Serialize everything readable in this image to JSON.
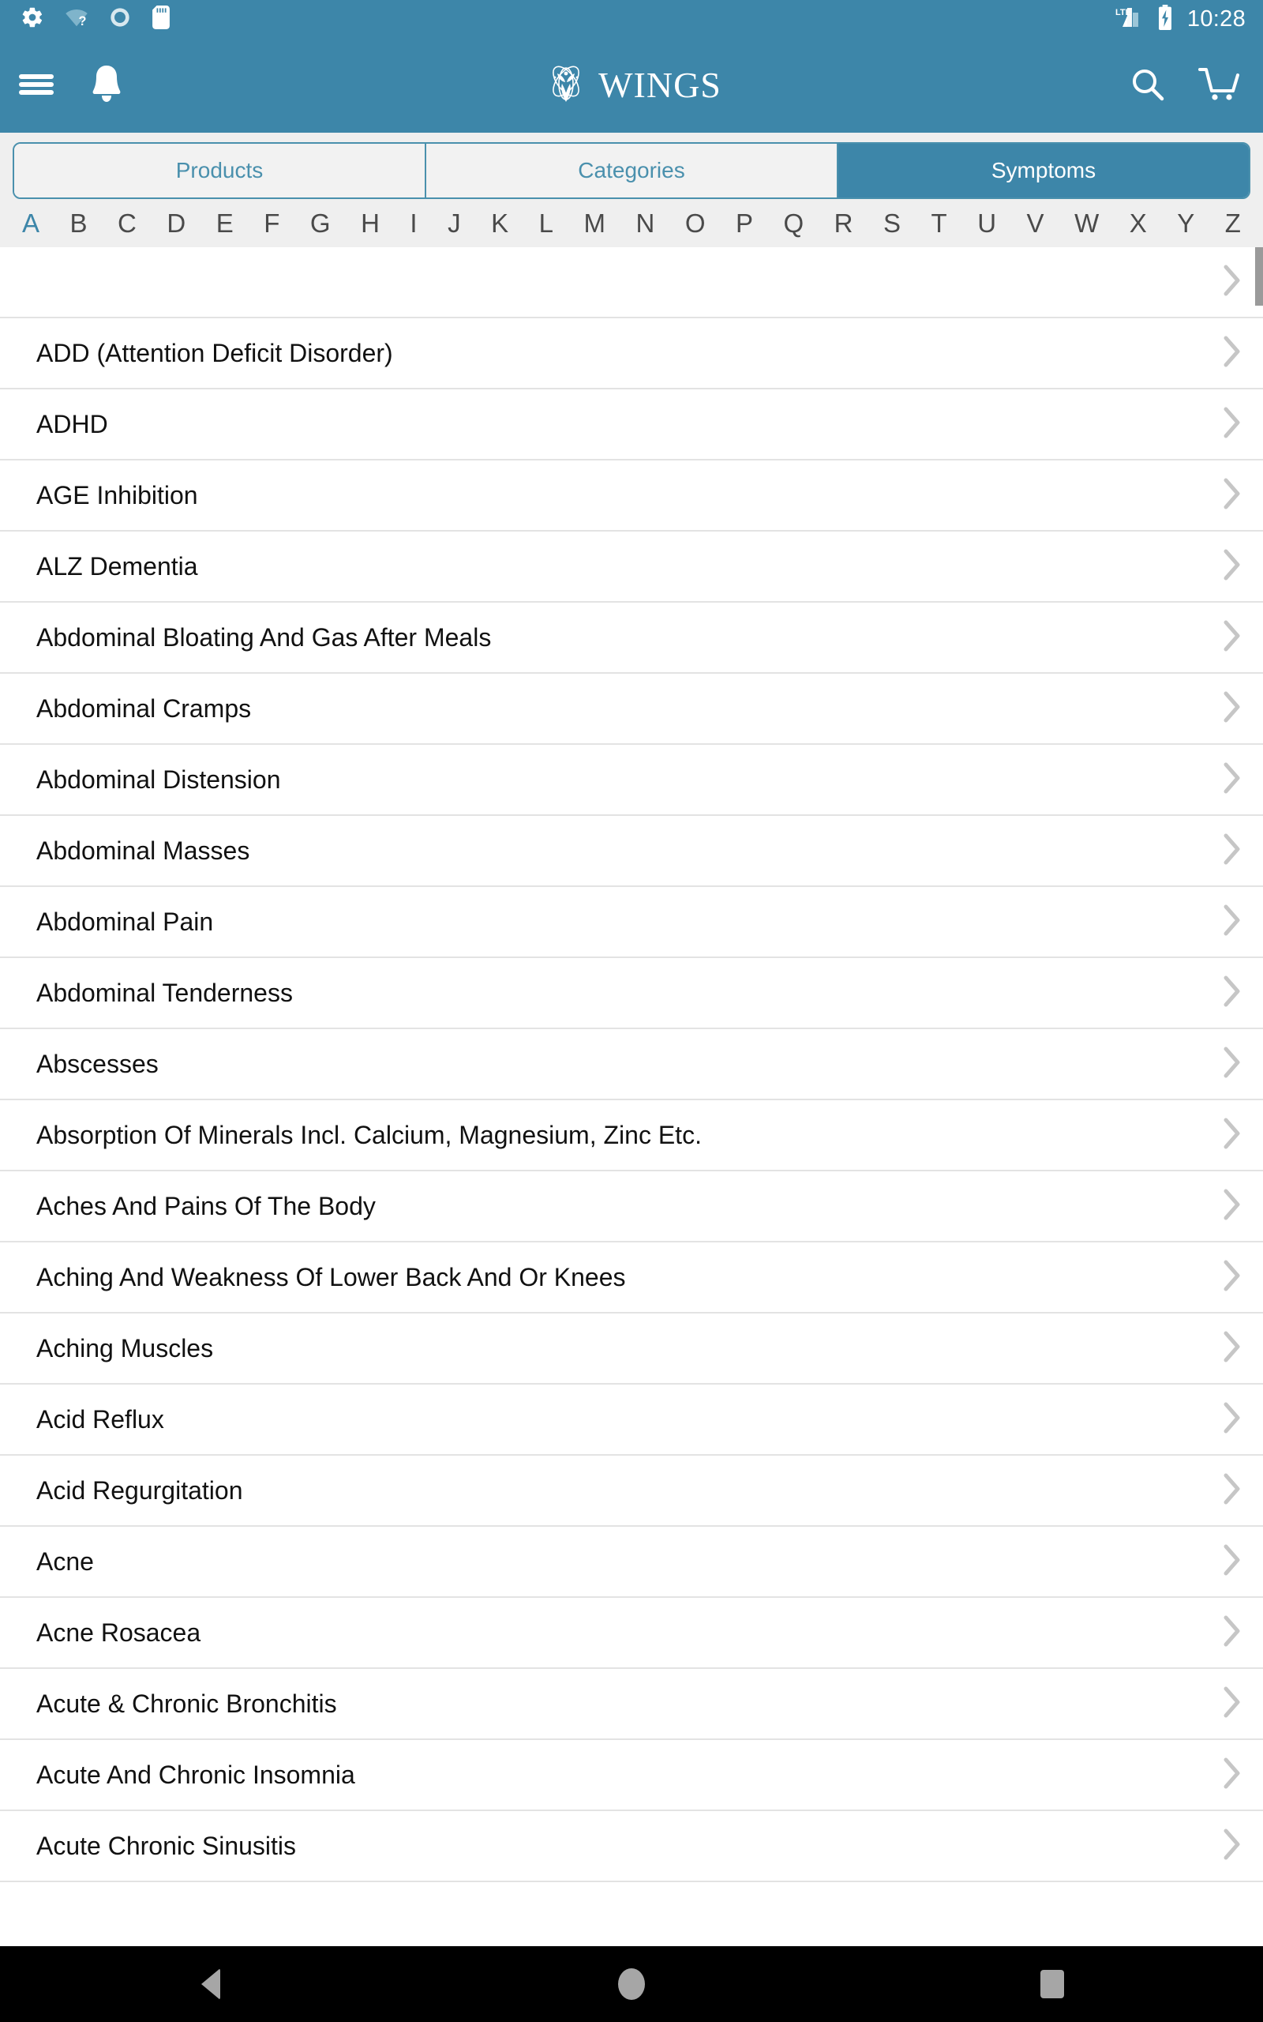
{
  "status_bar": {
    "icons": [
      "gear-icon",
      "wifi-question-icon",
      "sync-circle-icon",
      "sd-card-icon"
    ],
    "network_label": "LTE",
    "right_icons": [
      "lte-signal-icon",
      "battery-charging-icon"
    ],
    "time": "10:28"
  },
  "header": {
    "menu_icon": "hamburger-menu-icon",
    "notification_icon": "bell-icon",
    "brand_name": "WINGS",
    "brand_logo_icon": "wings-floral-logo-icon",
    "search_icon": "search-icon",
    "cart_icon": "shopping-cart-icon",
    "background_color": "#3d86a9"
  },
  "tabs": {
    "items": [
      {
        "label": "Products",
        "active": false
      },
      {
        "label": "Categories",
        "active": false
      },
      {
        "label": "Symptoms",
        "active": true
      }
    ],
    "active_color": "#3d86a9",
    "inactive_text_color": "#4a90ad"
  },
  "alphabet_index": {
    "letters": [
      "A",
      "B",
      "C",
      "D",
      "E",
      "F",
      "G",
      "H",
      "I",
      "J",
      "K",
      "L",
      "M",
      "N",
      "O",
      "P",
      "Q",
      "R",
      "S",
      "T",
      "U",
      "V",
      "W",
      "X",
      "Y",
      "Z"
    ],
    "active_letter": "A",
    "active_color": "#3d86a9",
    "inactive_color": "#4a4a4a"
  },
  "list": {
    "chevron_icon": "chevron-right-icon",
    "items": [
      {
        "label": ""
      },
      {
        "label": "ADD (Attention Deficit Disorder)"
      },
      {
        "label": "ADHD"
      },
      {
        "label": "AGE Inhibition"
      },
      {
        "label": "ALZ Dementia"
      },
      {
        "label": "Abdominal Bloating And Gas After Meals"
      },
      {
        "label": "Abdominal Cramps"
      },
      {
        "label": "Abdominal Distension"
      },
      {
        "label": "Abdominal Masses"
      },
      {
        "label": "Abdominal Pain"
      },
      {
        "label": "Abdominal Tenderness"
      },
      {
        "label": "Abscesses"
      },
      {
        "label": "Absorption Of Minerals Incl. Calcium, Magnesium, Zinc Etc."
      },
      {
        "label": "Aches And Pains Of The Body"
      },
      {
        "label": "Aching And Weakness Of Lower Back And Or Knees"
      },
      {
        "label": "Aching Muscles"
      },
      {
        "label": "Acid Reflux"
      },
      {
        "label": "Acid Regurgitation"
      },
      {
        "label": "Acne"
      },
      {
        "label": "Acne Rosacea"
      },
      {
        "label": "Acute & Chronic Bronchitis"
      },
      {
        "label": "Acute And Chronic Insomnia"
      },
      {
        "label": "Acute Chronic Sinusitis"
      }
    ]
  },
  "nav_bar": {
    "back_icon": "back-triangle-icon",
    "home_icon": "home-circle-icon",
    "recents_icon": "recents-square-icon"
  }
}
